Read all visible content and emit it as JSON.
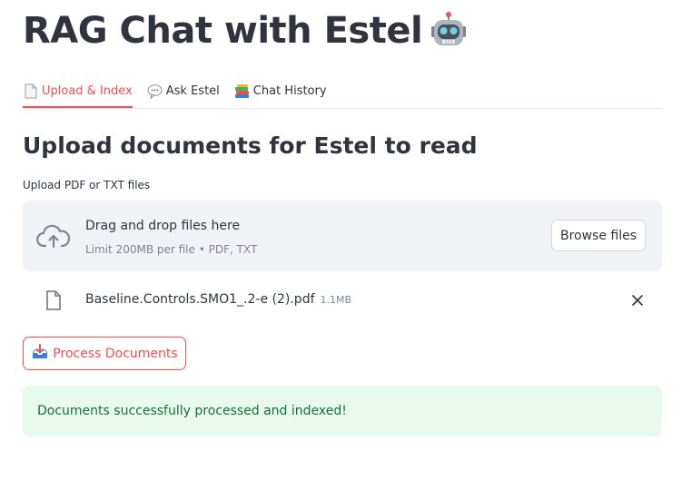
{
  "page": {
    "title": "RAG Chat with Estel",
    "title_emoji": "robot-icon"
  },
  "tabs": [
    {
      "label": "Upload & Index",
      "icon": "page-icon",
      "active": true
    },
    {
      "label": "Ask Estel",
      "icon": "speech-bubble-icon",
      "active": false
    },
    {
      "label": "Chat History",
      "icon": "books-icon",
      "active": false
    }
  ],
  "section": {
    "heading": "Upload documents for Estel to read"
  },
  "uploader": {
    "label": "Upload PDF or TXT files",
    "drag_text": "Drag and drop files here",
    "limit_text": "Limit 200MB per file • PDF, TXT",
    "browse_label": "Browse files",
    "icon": "cloud-upload-icon"
  },
  "files": [
    {
      "name": "Baseline.Controls.SMO1_.2-e (2).pdf",
      "size": "1.1MB",
      "icon": "file-icon"
    }
  ],
  "process_button": {
    "label": "Process Documents",
    "icon": "inbox-tray-icon"
  },
  "alert": {
    "message": "Documents successfully processed and indexed!",
    "type": "success"
  },
  "colors": {
    "accent": "#ff4b4b",
    "text": "#31333f",
    "dropzone_bg": "#f0f2f6",
    "success_bg": "#e8f9ee",
    "success_text": "#177233"
  }
}
